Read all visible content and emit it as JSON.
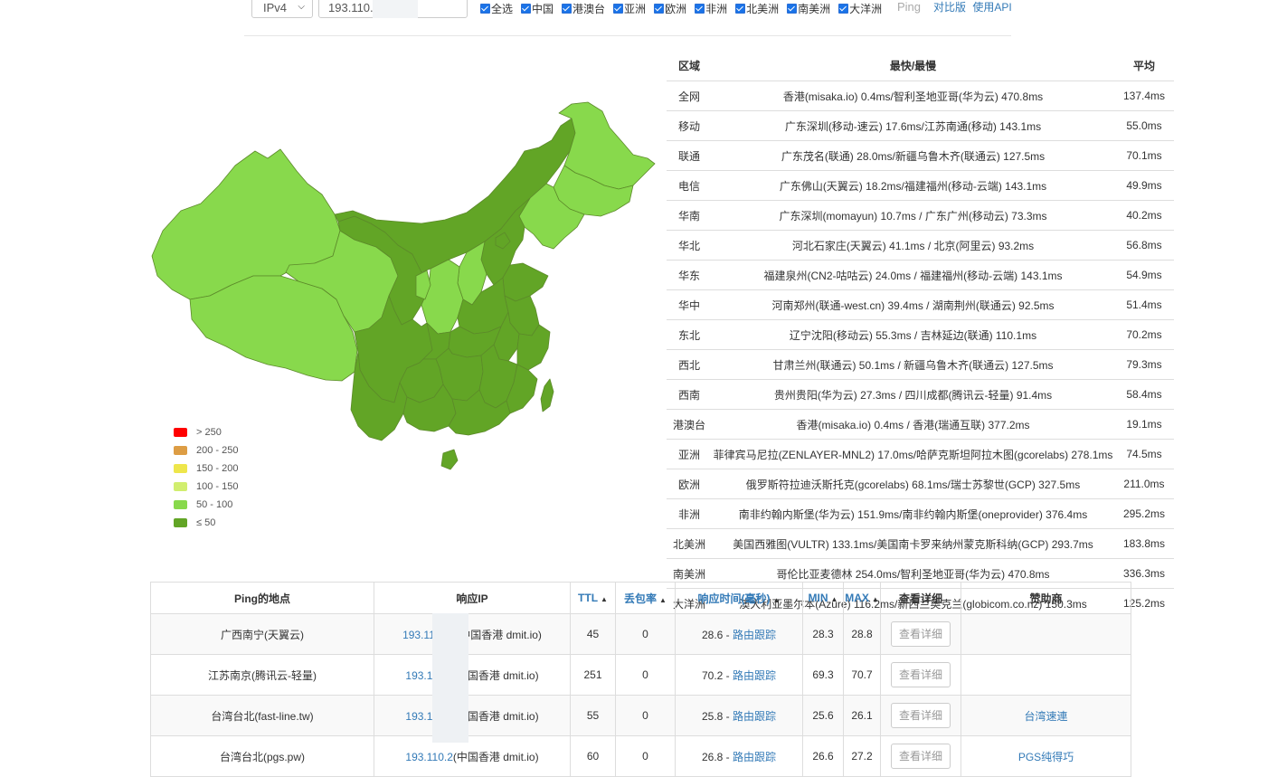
{
  "toolbar": {
    "ip_version": "IPv4",
    "ip_value": "193.110.",
    "checkboxes": [
      "全选",
      "中国",
      "港澳台",
      "亚洲",
      "欧洲",
      "非洲",
      "北美洲",
      "南美洲",
      "大洋洲"
    ],
    "ping_label": "Ping",
    "link_compare": "对比版",
    "link_api": "使用API"
  },
  "legend": [
    {
      "label": "> 250",
      "color": "#ff0000"
    },
    {
      "label": "200 - 250",
      "color": "#dd9d44"
    },
    {
      "label": "150 - 200",
      "color": "#eee64b"
    },
    {
      "label": "100 - 150",
      "color": "#d1ee6f"
    },
    {
      "label": "50 - 100",
      "color": "#88d94c"
    },
    {
      "label": "≤ 50",
      "color": "#62a526"
    }
  ],
  "region_table": {
    "headers": [
      "区域",
      "最快/最慢",
      "平均"
    ],
    "rows": [
      [
        "全网",
        "香港(misaka.io) 0.4ms/智利圣地亚哥(华为云) 470.8ms",
        "137.4ms"
      ],
      [
        "移动",
        "广东深圳(移动-速云) 17.6ms/江苏南通(移动) 143.1ms",
        "55.0ms"
      ],
      [
        "联通",
        "广东茂名(联通) 28.0ms/新疆乌鲁木齐(联通云) 127.5ms",
        "70.1ms"
      ],
      [
        "电信",
        "广东佛山(天翼云) 18.2ms/福建福州(移动-云端) 143.1ms",
        "49.9ms"
      ],
      [
        "华南",
        "广东深圳(momayun) 10.7ms / 广东广州(移动云) 73.3ms",
        "40.2ms"
      ],
      [
        "华北",
        "河北石家庄(天翼云) 41.1ms / 北京(阿里云) 93.2ms",
        "56.8ms"
      ],
      [
        "华东",
        "福建泉州(CN2-咕咕云) 24.0ms / 福建福州(移动-云端) 143.1ms",
        "54.9ms"
      ],
      [
        "华中",
        "河南郑州(联通-west.cn) 39.4ms / 湖南荆州(联通云) 92.5ms",
        "51.4ms"
      ],
      [
        "东北",
        "辽宁沈阳(移动云) 55.3ms / 吉林延边(联通) 110.1ms",
        "70.2ms"
      ],
      [
        "西北",
        "甘肃兰州(联通云) 50.1ms / 新疆乌鲁木齐(联通云) 127.5ms",
        "79.3ms"
      ],
      [
        "西南",
        "贵州贵阳(华为云) 27.3ms / 四川成都(腾讯云-轻量) 91.4ms",
        "58.4ms"
      ],
      [
        "港澳台",
        "香港(misaka.io) 0.4ms / 香港(瑞通互联) 377.2ms",
        "19.1ms"
      ],
      [
        "亚洲",
        "菲律宾马尼拉(ZENLAYER-MNL2) 17.0ms/哈萨克斯坦阿拉木图(gcorelabs) 278.1ms",
        "74.5ms"
      ],
      [
        "欧洲",
        "俄罗斯符拉迪沃斯托克(gcorelabs) 68.1ms/瑞士苏黎世(GCP) 327.5ms",
        "211.0ms"
      ],
      [
        "非洲",
        "南非约翰内斯堡(华为云) 151.9ms/南非约翰内斯堡(oneprovider) 376.4ms",
        "295.2ms"
      ],
      [
        "北美洲",
        "美国西雅图(VULTR) 133.1ms/美国南卡罗来纳州蒙克斯科纳(GCP) 293.7ms",
        "183.8ms"
      ],
      [
        "南美洲",
        "哥伦比亚麦德林 254.0ms/智利圣地亚哥(华为云) 470.8ms",
        "336.3ms"
      ],
      [
        "大洋洲",
        "澳大利亚墨尔本(Azure) 116.2ms/新西兰奥克兰(globicom.co.nz) 150.3ms",
        "125.2ms"
      ]
    ]
  },
  "ping_table": {
    "headers": [
      "Ping的地点",
      "响应IP",
      "TTL",
      "丢包率",
      "响应时间(毫秒)",
      "MIN",
      "MAX",
      "查看详细",
      "赞助商"
    ],
    "trace_label": "路由跟踪",
    "detail_label": "查看详细",
    "rows": [
      {
        "location": "广西南宁(天翼云)",
        "ip": "193.110.2",
        "ip_tail": "1(中国香港 dmit.io)",
        "ttl": "45",
        "loss": "0",
        "time": "28.6",
        "min": "28.3",
        "max": "28.8",
        "sponsor": ""
      },
      {
        "location": "江苏南京(腾讯云-轻量)",
        "ip": "193.110.2",
        "ip_tail": "(中国香港 dmit.io)",
        "ttl": "251",
        "loss": "0",
        "time": "70.2",
        "min": "69.3",
        "max": "70.7",
        "sponsor": ""
      },
      {
        "location": "台湾台北(fast-line.tw)",
        "ip": "193.110.2",
        "ip_tail": "(中国香港 dmit.io)",
        "ttl": "55",
        "loss": "0",
        "time": "25.8",
        "min": "25.6",
        "max": "26.1",
        "sponsor": "台湾速連"
      },
      {
        "location": "台湾台北(pgs.pw)",
        "ip": "193.110.2",
        "ip_tail": "(中国香港 dmit.io)",
        "ttl": "60",
        "loss": "0",
        "time": "26.8",
        "min": "26.6",
        "max": "27.2",
        "sponsor": "PGS纯得巧"
      }
    ]
  }
}
